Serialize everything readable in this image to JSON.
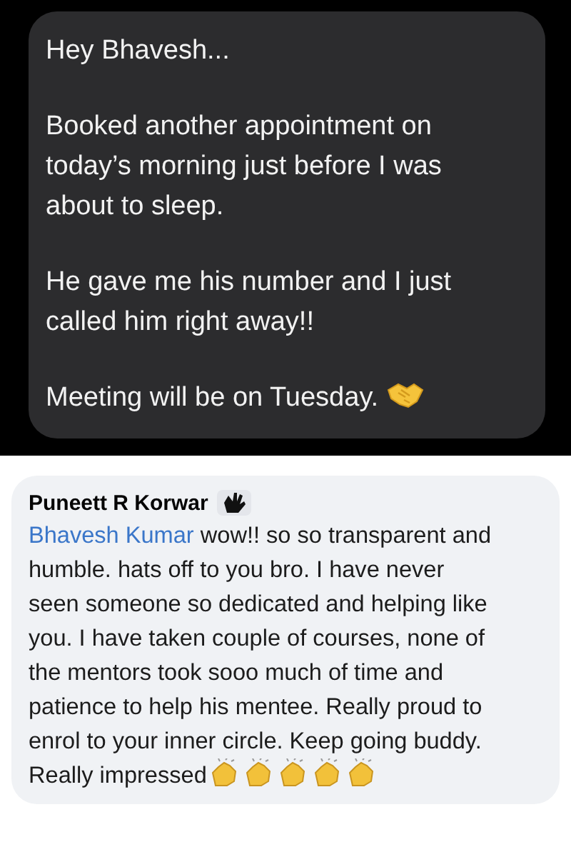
{
  "message": {
    "paragraphs": [
      "Hey Bhavesh...",
      "Booked another appointment on today’s morning just before I was about to sleep.",
      "He gave me his number and I just called him right away!!",
      "Meeting will be on Tuesday."
    ]
  },
  "comment": {
    "author": "Puneett R Korwar",
    "mention": "Bhavesh Kumar",
    "text": "wow!! so so transparent and humble. hats off to you bro. I have never seen someone so dedicated and helping like you. I have taken couple of courses, none of the mentors took sooo much of time and patience to help his mentee. Really proud to enrol to your inner circle. Keep going buddy. Really impressed"
  }
}
